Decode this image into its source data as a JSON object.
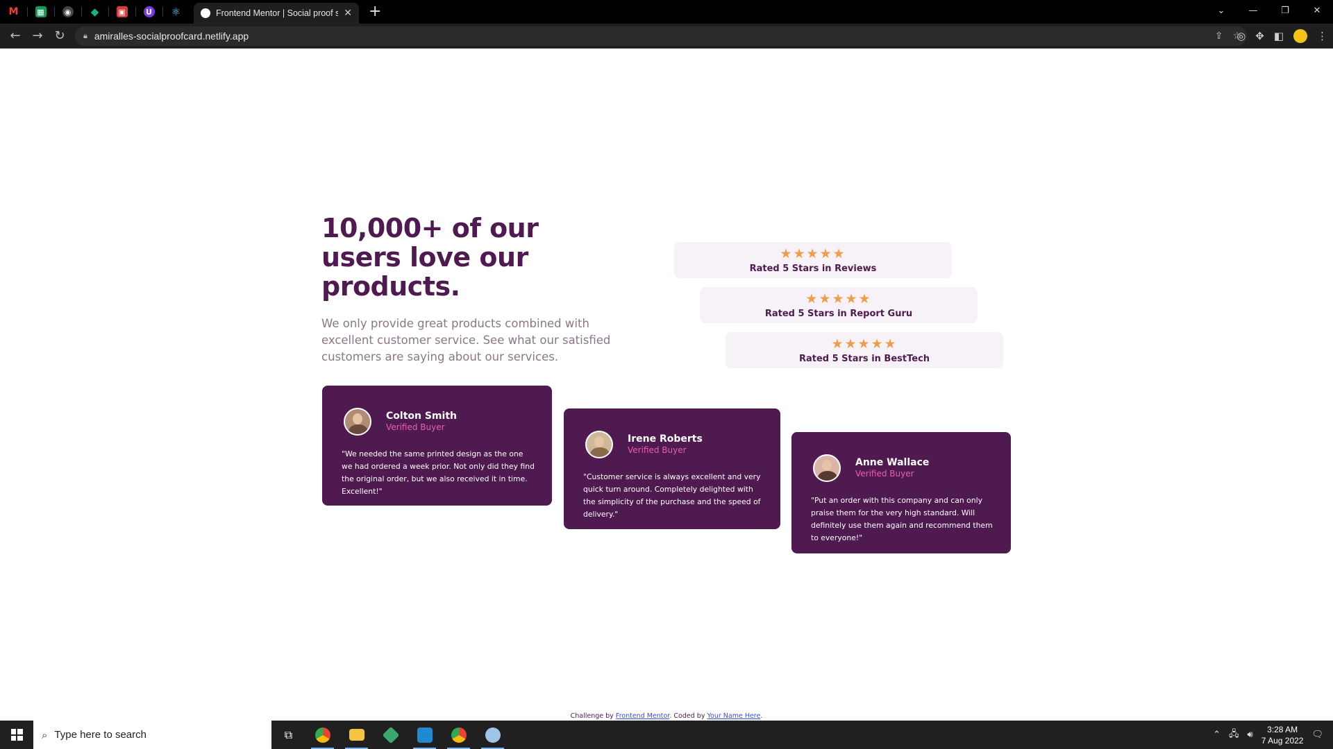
{
  "browser": {
    "active_tab_title": "Frontend Mentor | Social proof section",
    "url": "amiralles-socialproofcard.netlify.app",
    "pinned_tabs": [
      {
        "name": "gmail-tab",
        "glyph": "M",
        "color": "#ea4335"
      },
      {
        "name": "sheets-tab",
        "glyph": "▦",
        "color": "#0f9d58"
      },
      {
        "name": "github-tab",
        "glyph": "◉",
        "color": "#444444"
      },
      {
        "name": "tab-4",
        "glyph": "◆",
        "color": "#12b48a"
      },
      {
        "name": "tab-5",
        "glyph": "▣",
        "color": "#d83b3b"
      },
      {
        "name": "tab-6",
        "glyph": "U",
        "color": "#7c3aed"
      },
      {
        "name": "react-tab",
        "glyph": "⚛",
        "color": "#61dafb"
      }
    ]
  },
  "headline": "10,000+ of our users love our products.",
  "intro": "We only provide great products combined with excellent customer service. See what our satisfied customers are saying about our services.",
  "ratings": [
    {
      "stars": "★★★★★",
      "label": "Rated 5 Stars in Reviews"
    },
    {
      "stars": "★★★★★",
      "label": "Rated 5 Stars in Report Guru"
    },
    {
      "stars": "★★★★★",
      "label": "Rated 5 Stars in BestTech"
    }
  ],
  "testimonials": [
    {
      "name": "Colton Smith",
      "badge": "Verified Buyer",
      "quote": "\"We needed the same printed design as the one we had ordered a week prior. Not only did they find the original order, but we also received it in time. Excellent!\""
    },
    {
      "name": "Irene Roberts",
      "badge": "Verified Buyer",
      "quote": "\"Customer service is always excellent and very quick turn around. Completely delighted with the simplicity of the purchase and the speed of delivery.\""
    },
    {
      "name": "Anne Wallace",
      "badge": "Verified Buyer",
      "quote": "\"Put an order with this company and can only praise them for the very high standard. Will definitely use them again and recommend them to everyone!\""
    }
  ],
  "footer": {
    "prefix": "Challenge by ",
    "link1": "Frontend Mentor",
    "middle": ". Coded by ",
    "link2": "Your Name Here",
    "suffix": "."
  },
  "taskbar": {
    "search_placeholder": "Type here to search",
    "time": "3:28 AM",
    "date": "7 Aug 2022"
  },
  "colors": {
    "brand_purple": "#4f1a4f",
    "accent_pink": "#ea5fb0",
    "star_orange": "#ee9d4a",
    "rating_bg": "#f7f2f7"
  }
}
